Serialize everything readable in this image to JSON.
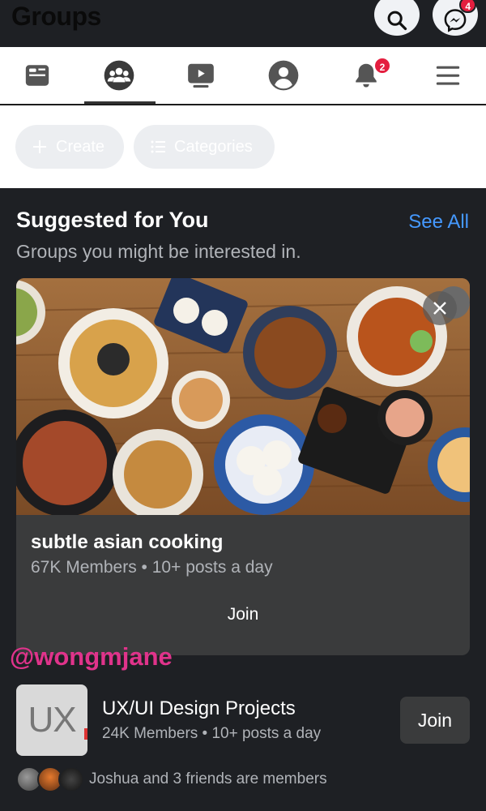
{
  "header": {
    "title": "Groups",
    "messenger_badge": "4"
  },
  "nav": {
    "items": [
      {
        "name": "news-feed",
        "icon": "feed-icon"
      },
      {
        "name": "groups",
        "icon": "groups-icon",
        "active": true
      },
      {
        "name": "watch",
        "icon": "video-icon"
      },
      {
        "name": "profile",
        "icon": "profile-icon"
      },
      {
        "name": "notifications",
        "icon": "bell-icon",
        "badge": "2"
      },
      {
        "name": "menu",
        "icon": "hamburger-icon"
      }
    ]
  },
  "actions": {
    "create_label": "Create",
    "categories_label": "Categories"
  },
  "suggested": {
    "title": "Suggested for You",
    "see_all": "See All",
    "subtitle": "Groups you might be interested in.",
    "card": {
      "name": "subtle asian cooking",
      "meta": "67K Members • 10+ posts a day",
      "join_label": "Join"
    }
  },
  "watermark": "@wongmjane",
  "group_row": {
    "thumb_text": "UX",
    "name": "UX/UI Design Projects",
    "meta": "24K Members • 10+ posts a day",
    "join_label": "Join",
    "friends": "Joshua and 3 friends are members"
  },
  "colors": {
    "accent": "#4599ff",
    "badge": "#e41e3f",
    "watermark": "#e0338b",
    "background": "#1e2024",
    "card": "#3a3b3c"
  }
}
